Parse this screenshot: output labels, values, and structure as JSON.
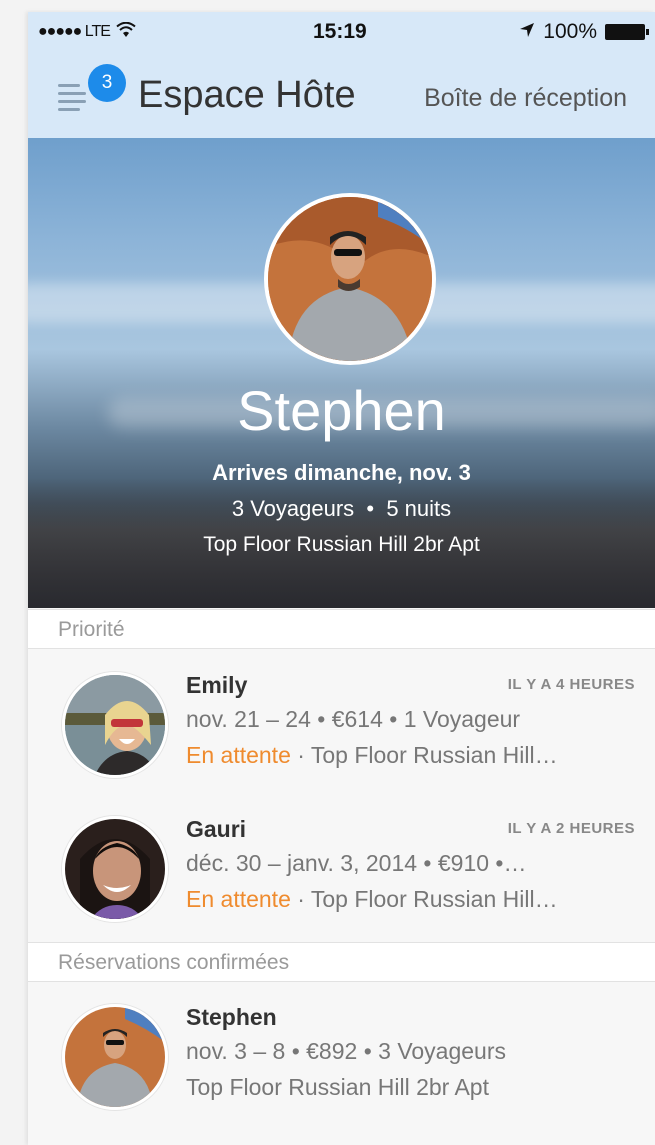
{
  "status_bar": {
    "signal": "●●●●● LTE",
    "time": "15:19",
    "battery": "100%"
  },
  "nav": {
    "badge_count": "3",
    "title": "Espace Hôte",
    "inbox_label": "Boîte de réception"
  },
  "hero": {
    "guest_name": "Stephen",
    "arrival": "Arrives dimanche, nov. 3",
    "guests": "3 Voyageurs",
    "separator": "•",
    "nights": "5 nuits",
    "listing": "Top Floor Russian Hill 2br Apt"
  },
  "sections": {
    "priority": "Priorité",
    "confirmed": "Réservations confirmées"
  },
  "priority_items": [
    {
      "name": "Emily",
      "time_ago": "IL Y A 4 HEURES",
      "details": "nov. 21 – 24 • €614 • 1 Voyageur",
      "status": "En attente",
      "listing": " · Top Floor Russian Hill…"
    },
    {
      "name": "Gauri",
      "time_ago": "IL Y A 2 HEURES",
      "details": "déc. 30 – janv. 3, 2014 • €910 •…",
      "status": "En attente",
      "listing": " · Top Floor Russian Hill…"
    }
  ],
  "confirmed_items": [
    {
      "name": "Stephen",
      "details": "nov. 3 – 8 • €892 • 3 Voyageurs",
      "listing": "Top Floor Russian Hill 2br Apt"
    }
  ],
  "colors": {
    "accent": "#1d8bea",
    "pending": "#ef8b2e",
    "nav_bg": "#d7e8f8"
  }
}
